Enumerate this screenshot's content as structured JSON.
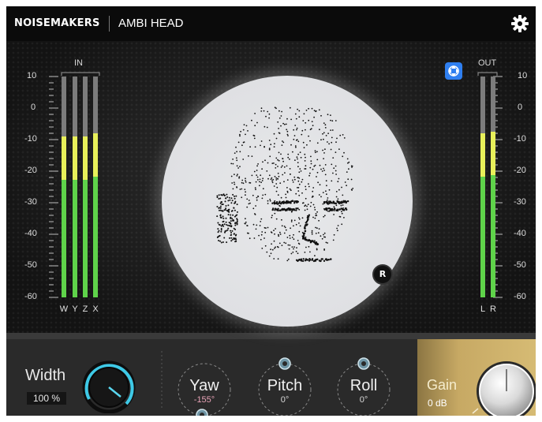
{
  "header": {
    "brand": "NOISEMAKERS",
    "product": "AMBI HEAD",
    "settings_icon": "gear-icon"
  },
  "meters": {
    "in": {
      "label": "IN",
      "channels": [
        "W",
        "Y",
        "Z",
        "X"
      ],
      "levels_db": [
        -9,
        -9,
        -9,
        -8
      ]
    },
    "out": {
      "label": "OUT",
      "channels": [
        "L",
        "R"
      ],
      "levels_db": [
        -8,
        -7.5
      ]
    },
    "scale": [
      "10",
      "0",
      "-10",
      "-20",
      "-30",
      "-40",
      "-50",
      "-60"
    ],
    "scale_min_db": -60,
    "scale_max_db": 10
  },
  "stage": {
    "r_badge": "R",
    "out_button_icon": "ambisonic-view-icon"
  },
  "controls": {
    "width": {
      "label": "Width",
      "value": "100 %"
    },
    "yaw": {
      "label": "Yaw",
      "value": "-155°"
    },
    "pitch": {
      "label": "Pitch",
      "value": "0°"
    },
    "roll": {
      "label": "Roll",
      "value": "0°"
    },
    "gain": {
      "label": "Gain",
      "value": "0 dB"
    }
  },
  "colors": {
    "meter_green": "#5fd34a",
    "meter_yellow": "#e8f05a",
    "accent_blue": "#3a8bf0",
    "gain_gold": "#c7a964",
    "yaw_value": "#e7a2b6"
  }
}
